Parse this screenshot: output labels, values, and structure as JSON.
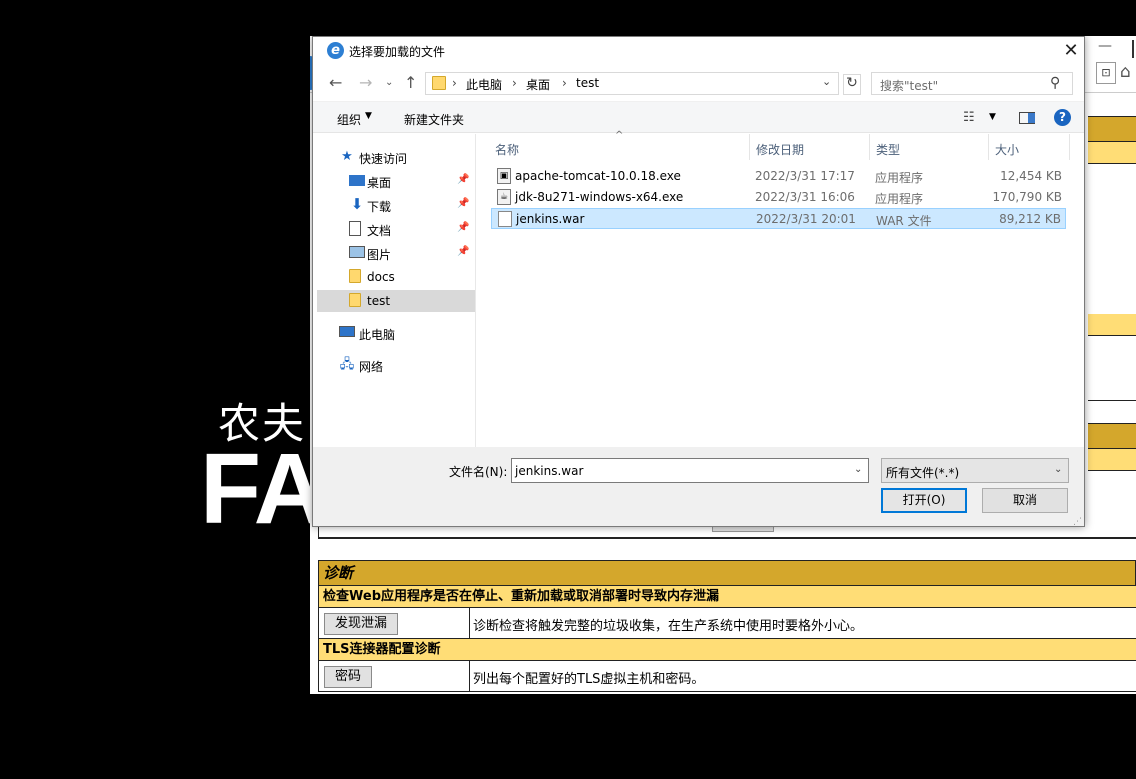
{
  "background": {
    "logo_cn": "农夫",
    "logo_en": "FA",
    "browser_minimize": "—",
    "diag": {
      "title": "诊断",
      "section1": "检查Web应用程序是否在停止、重新加载或取消部署时导致内存泄漏",
      "btn1": "发现泄漏",
      "desc1": "诊断检查将触发完整的垃圾收集，在生产系统中使用时要格外小心。",
      "section2": "TLS连接器配置诊断",
      "btn2": "密码",
      "desc2": "列出每个配置好的TLS虚拟主机和密码。"
    }
  },
  "dialog": {
    "title": "选择要加载的文件",
    "breadcrumb": [
      "此电脑",
      "桌面",
      "test"
    ],
    "search_placeholder": "搜索\"test\"",
    "toolbar": {
      "organize": "组织",
      "new_folder": "新建文件夹"
    },
    "nav": {
      "quick_access": "快速访问",
      "desktop": "桌面",
      "downloads": "下载",
      "documents": "文档",
      "pictures": "图片",
      "docs": "docs",
      "test": "test",
      "this_pc": "此电脑",
      "network": "网络"
    },
    "columns": {
      "name": "名称",
      "date": "修改日期",
      "type": "类型",
      "size": "大小"
    },
    "files": [
      {
        "name": "apache-tomcat-10.0.18.exe",
        "date": "2022/3/31 17:17",
        "type": "应用程序",
        "size": "12,454 KB"
      },
      {
        "name": "jdk-8u271-windows-x64.exe",
        "date": "2022/3/31 16:06",
        "type": "应用程序",
        "size": "170,790 KB"
      },
      {
        "name": "jenkins.war",
        "date": "2022/3/31 20:01",
        "type": "WAR 文件",
        "size": "89,212 KB"
      }
    ],
    "filename_label": "文件名(N):",
    "filename_value": "jenkins.war",
    "filetype_value": "所有文件(*.*)",
    "open_label": "打开(O)",
    "cancel_label": "取消"
  },
  "colors": {
    "accent": "#0078d7",
    "selection": "#cce8ff",
    "tomcat_header": "#d4a72c",
    "tomcat_subheader": "#ffdd76"
  }
}
